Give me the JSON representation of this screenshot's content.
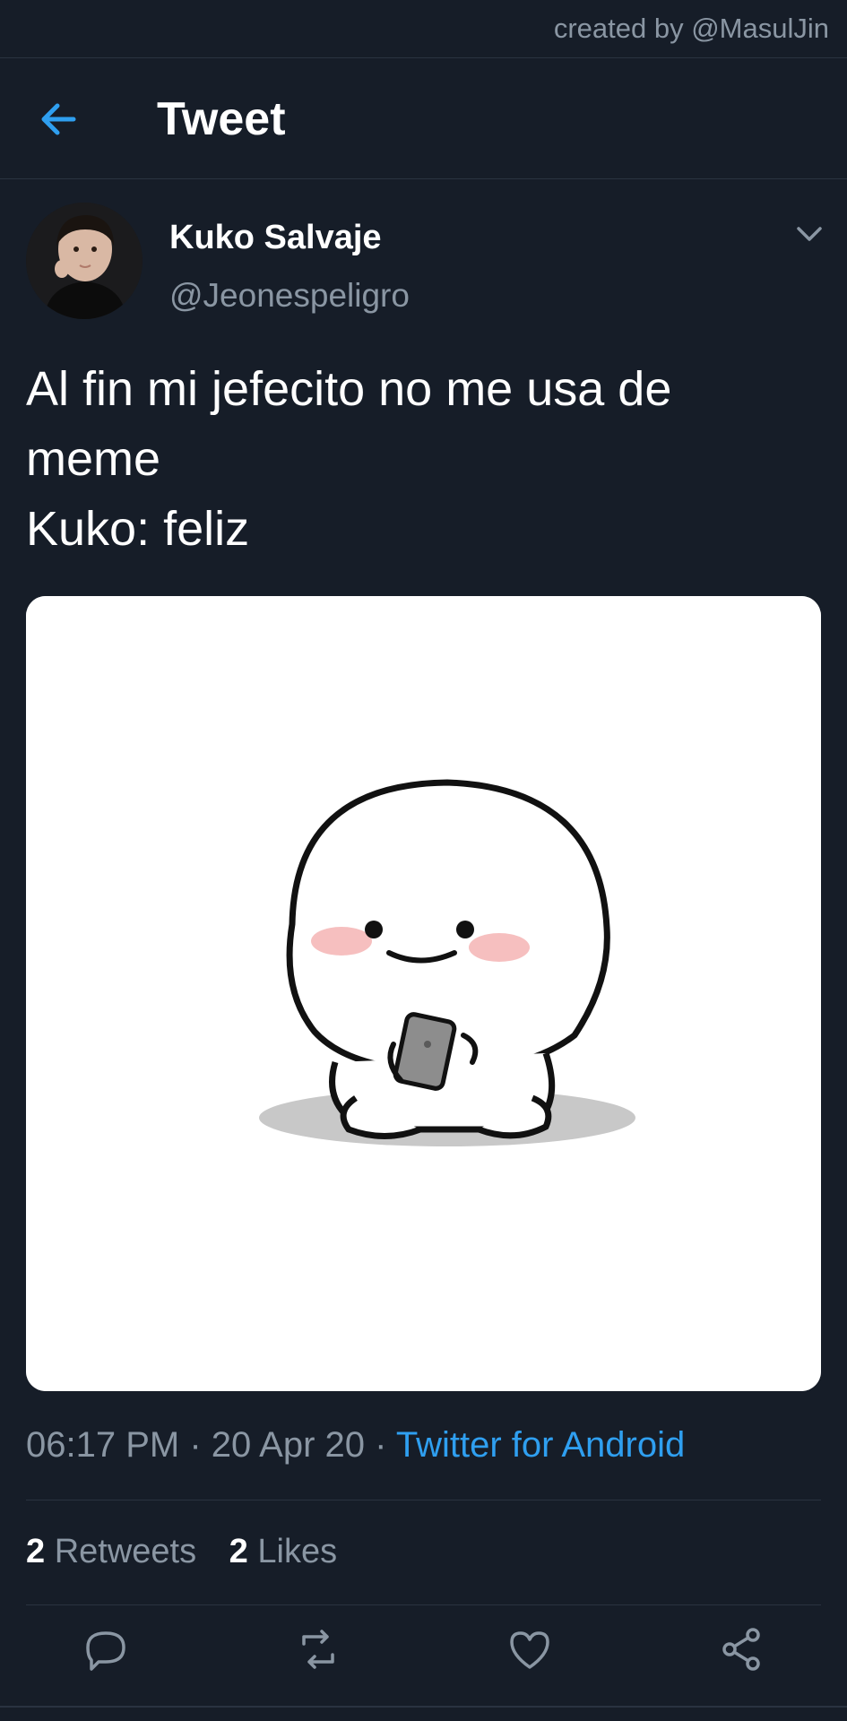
{
  "credit": "created by @MasulJin",
  "header": {
    "back_icon": "arrow-left-icon",
    "title": "Tweet"
  },
  "tweet": {
    "author_name": "Kuko Salvaje",
    "author_handle": "@Jeonespeligro",
    "text_lines": [
      "Al fin mi jefecito no me usa de",
      "meme",
      "Kuko: feliz"
    ],
    "time": "06:17 PM",
    "date": "20 Apr 20",
    "source": "Twitter for Android",
    "retweets_count": "2",
    "retweets_label": "Retweets",
    "likes_count": "2",
    "likes_label": "Likes"
  },
  "actions": [
    {
      "icon": "reply-icon"
    },
    {
      "icon": "retweet-icon"
    },
    {
      "icon": "like-heart-icon"
    },
    {
      "icon": "share-icon"
    }
  ],
  "colors": {
    "background": "#161d28",
    "accent": "#2f9ff0",
    "secondary_text": "#8a96a3",
    "divider": "#2a3340"
  }
}
